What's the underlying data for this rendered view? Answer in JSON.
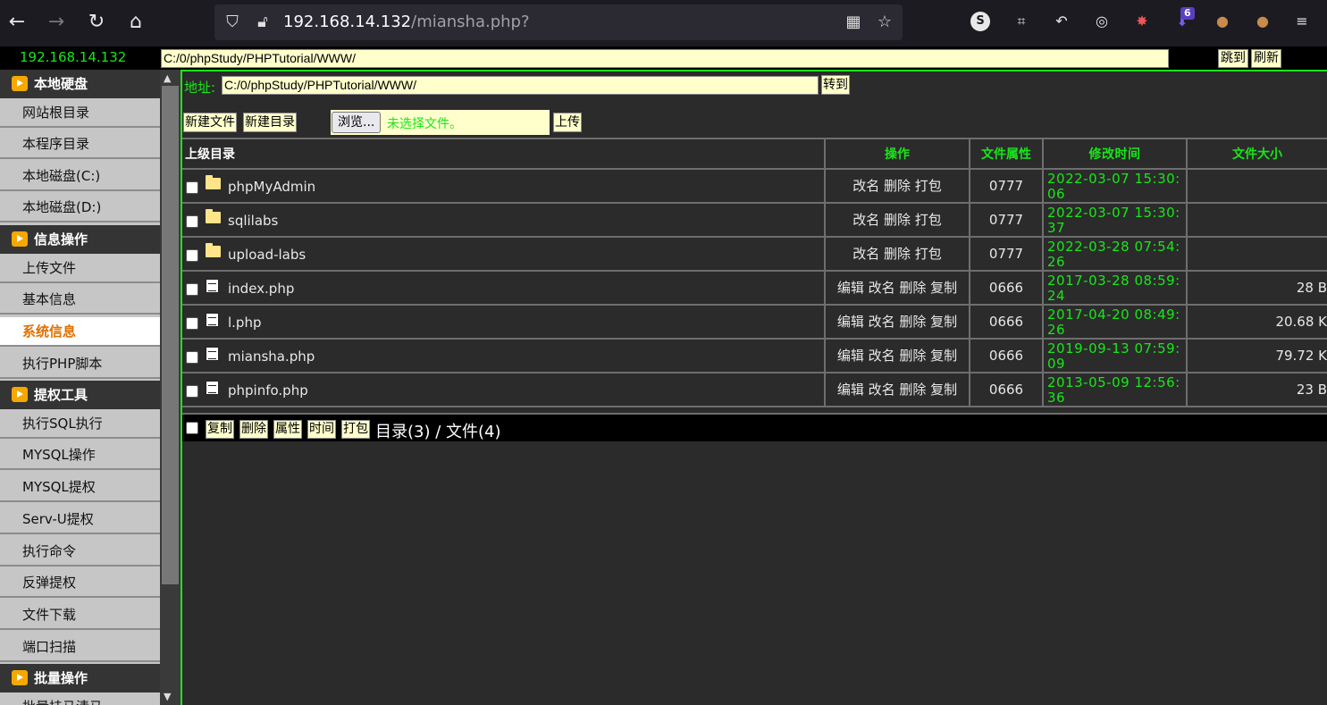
{
  "browser": {
    "url_host": "192.168.14.132",
    "url_path": "/miansha.php?",
    "badge_count": "6",
    "icons": [
      "back-icon",
      "forward-icon",
      "reload-icon",
      "home-icon",
      "shield-icon",
      "insecure-lock-icon",
      "qr-icon",
      "star-icon"
    ]
  },
  "topbar": {
    "ip": "192.168.14.132",
    "path": "C:/0/phpStudy/PHPTutorial/WWW/",
    "jump_label": "跳到",
    "refresh_label": "刷新"
  },
  "sidebar": {
    "groups": [
      {
        "title": "本地硬盘",
        "items": [
          "网站根目录",
          "本程序目录",
          "本地磁盘(C:)",
          "本地磁盘(D:)"
        ]
      },
      {
        "title": "信息操作",
        "items": [
          "上传文件",
          "基本信息",
          "系统信息",
          "执行PHP脚本"
        ]
      },
      {
        "title": "提权工具",
        "items": [
          "执行SQL执行",
          "MYSQL操作",
          "MYSQL提权",
          "Serv-U提权",
          "执行命令",
          "反弹提权",
          "文件下载",
          "端口扫描"
        ]
      },
      {
        "title": "批量操作",
        "items": [
          "批量挂马清马"
        ]
      }
    ],
    "active_item": "系统信息"
  },
  "main": {
    "addr_label": "地址:",
    "addr_value": "C:/0/phpStudy/PHPTutorial/WWW/",
    "goto_label": "转到",
    "new_file_label": "新建文件",
    "new_dir_label": "新建目录",
    "browse_label": "浏览...",
    "no_file_label": "未选择文件。",
    "upload_label": "上传"
  },
  "table": {
    "headers": {
      "name": "上级目录",
      "op": "操作",
      "attr": "文件属性",
      "time": "修改时间",
      "size": "文件大小"
    },
    "rows": [
      {
        "type": "folder",
        "name": "phpMyAdmin",
        "op": "改名 删除 打包",
        "attr": "0777",
        "time1": "2022-03-07 15:30:",
        "time2": "06",
        "size": ""
      },
      {
        "type": "folder",
        "name": "sqlilabs",
        "op": "改名 删除 打包",
        "attr": "0777",
        "time1": "2022-03-07 15:30:",
        "time2": "37",
        "size": ""
      },
      {
        "type": "folder",
        "name": "upload-labs",
        "op": "改名 删除 打包",
        "attr": "0777",
        "time1": "2022-03-28 07:54:",
        "time2": "26",
        "size": ""
      },
      {
        "type": "file",
        "name": "index.php",
        "op": "编辑 改名 删除 复制",
        "attr": "0666",
        "time1": "2017-03-28 08:59:",
        "time2": "24",
        "size": "28 B"
      },
      {
        "type": "file",
        "name": "l.php",
        "op": "编辑 改名 删除 复制",
        "attr": "0666",
        "time1": "2017-04-20 08:49:",
        "time2": "26",
        "size": "20.68 K"
      },
      {
        "type": "file",
        "name": "miansha.php",
        "op": "编辑 改名 删除 复制",
        "attr": "0666",
        "time1": "2019-09-13 07:59:",
        "time2": "09",
        "size": "79.72 K"
      },
      {
        "type": "file",
        "name": "phpinfo.php",
        "op": "编辑 改名 删除 复制",
        "attr": "0666",
        "time1": "2013-05-09 12:56:",
        "time2": "36",
        "size": "23 B"
      }
    ]
  },
  "footer": {
    "copy_label": "复制",
    "delete_label": "删除",
    "attr_label": "属性",
    "time_label": "时间",
    "pack_label": "打包",
    "summary": "目录(3) / 文件(4)"
  }
}
